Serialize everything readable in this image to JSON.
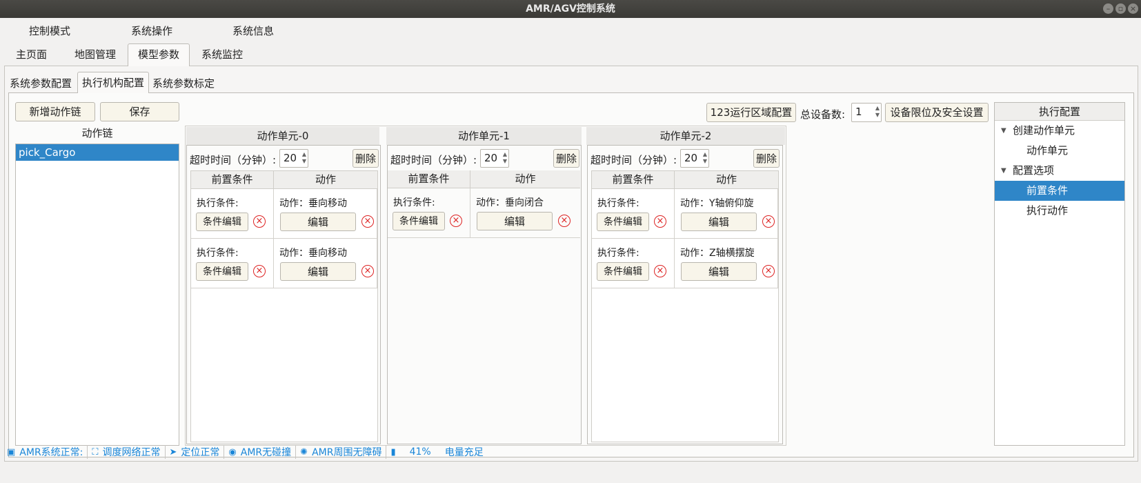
{
  "window": {
    "title": "AMR/AGV控制系统"
  },
  "menu": [
    "控制模式",
    "系统操作",
    "系统信息"
  ],
  "main_tabs": [
    "主页面",
    "地图管理",
    "模型参数",
    "系统监控"
  ],
  "sub_tabs": [
    "系统参数配置",
    "执行机构配置",
    "系统参数标定"
  ],
  "toolbar": {
    "add_chain": "新增动作链",
    "save": "保存",
    "zone_config": "123运行区域配置",
    "device_count_label": "总设备数:",
    "device_count": "1",
    "limits_button": "设备限位及安全设置"
  },
  "chain_list": {
    "header": "动作链",
    "items": [
      "pick_Cargo"
    ]
  },
  "common": {
    "timeout_label": "超时时间（分钟）:",
    "delete": "删除",
    "col_pre": "前置条件",
    "col_action": "动作",
    "exec_cond": "执行条件:",
    "cond_edit": "条件编辑",
    "edit": "编辑"
  },
  "units": [
    {
      "title": "动作单元-0",
      "timeout": "20",
      "rows": [
        "动作：垂向移动",
        "动作：垂向移动"
      ]
    },
    {
      "title": "动作单元-1",
      "timeout": "20",
      "rows": [
        "动作：垂向闭合"
      ]
    },
    {
      "title": "动作单元-2",
      "timeout": "20",
      "rows": [
        "动作：Y轴俯仰旋",
        "动作：Z轴横摆旋"
      ]
    }
  ],
  "tree": {
    "header": "执行配置",
    "nodes": [
      {
        "label": "创建动作单元",
        "level": 0
      },
      {
        "label": "动作单元",
        "level": 1
      },
      {
        "label": "配置选项",
        "level": 0
      },
      {
        "label": "前置条件",
        "level": 1
      },
      {
        "label": "执行动作",
        "level": 1
      }
    ]
  },
  "status": [
    {
      "icon": "window-icon",
      "text": "AMR系统正常:"
    },
    {
      "icon": "network-icon",
      "text": "调度网络正常"
    },
    {
      "icon": "location-icon",
      "text": "定位正常"
    },
    {
      "icon": "camera-icon",
      "text": "AMR无碰撞"
    },
    {
      "icon": "radar-icon",
      "text": "AMR周围无障碍"
    },
    {
      "icon": "battery-icon",
      "text": "41%"
    },
    {
      "icon": "battery-status-icon",
      "text": "电量充足"
    }
  ]
}
